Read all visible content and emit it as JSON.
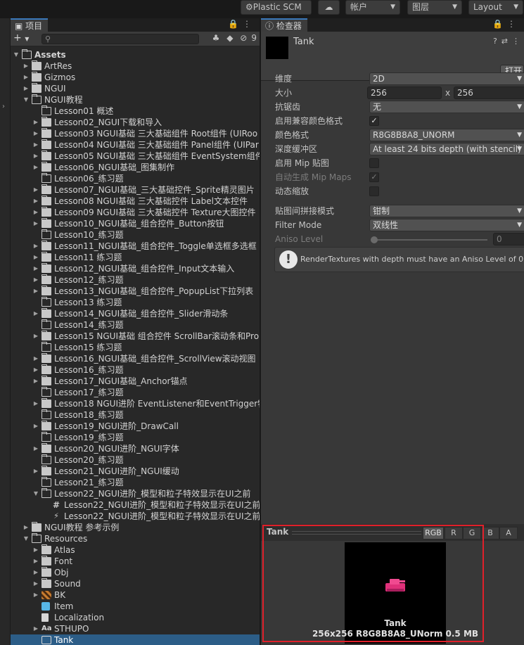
{
  "toolbar": {
    "plastic": "Plastic SCM",
    "account": "帐户",
    "layers": "图层",
    "layout": "Layout"
  },
  "project": {
    "tab_label": "项目",
    "search_placeholder": "",
    "hidden_count": "9",
    "tree": [
      {
        "label": "Assets",
        "depth": 0,
        "expanded": true,
        "icon": "folder-open",
        "bold": true
      },
      {
        "label": "ArtRes",
        "depth": 1,
        "expanded": false,
        "icon": "folder"
      },
      {
        "label": "Gizmos",
        "depth": 1,
        "expanded": false,
        "icon": "folder"
      },
      {
        "label": "NGUI",
        "depth": 1,
        "expanded": false,
        "icon": "folder"
      },
      {
        "label": "NGUI教程",
        "depth": 1,
        "expanded": true,
        "icon": "folder-open"
      },
      {
        "label": "Lesson01 概述",
        "depth": 2,
        "icon": "folder-empty"
      },
      {
        "label": "Lesson02_NGUI下载和导入",
        "depth": 2,
        "expanded": false,
        "icon": "folder"
      },
      {
        "label": "Lesson03 NGUI基础 三大基础组件 Root组件 (UIRoo",
        "depth": 2,
        "expanded": false,
        "icon": "folder"
      },
      {
        "label": "Lesson04 NGUI基础 三大基础组件 Panel组件 (UIPar",
        "depth": 2,
        "expanded": false,
        "icon": "folder"
      },
      {
        "label": "Lesson05 NGUI基础 三大基础组件 EventSystem组件",
        "depth": 2,
        "expanded": false,
        "icon": "folder"
      },
      {
        "label": "Lesson06_NGUI基础_图集制作",
        "depth": 2,
        "expanded": false,
        "icon": "folder"
      },
      {
        "label": "Lesson06_练习题",
        "depth": 2,
        "icon": "folder-empty"
      },
      {
        "label": "Lesson07_NGUI基础_三大基础控件_Sprite精灵图片",
        "depth": 2,
        "expanded": false,
        "icon": "folder"
      },
      {
        "label": "Lesson08 NGUI基础 三大基础控件 Label文本控件",
        "depth": 2,
        "expanded": false,
        "icon": "folder"
      },
      {
        "label": "Lesson09 NGUI基础 三大基础控件 Texture大图控件",
        "depth": 2,
        "expanded": false,
        "icon": "folder"
      },
      {
        "label": "Lesson10_NGUI基础_组合控件_Button按钮",
        "depth": 2,
        "expanded": false,
        "icon": "folder"
      },
      {
        "label": "Lesson10_练习题",
        "depth": 2,
        "icon": "folder-empty"
      },
      {
        "label": "Lesson11_NGUI基础_组合控件_Toggle单选框多选框",
        "depth": 2,
        "expanded": false,
        "icon": "folder"
      },
      {
        "label": "Lesson11 练习题",
        "depth": 2,
        "expanded": false,
        "icon": "folder"
      },
      {
        "label": "Lesson12_NGUI基础_组合控件_Input文本输入",
        "depth": 2,
        "expanded": false,
        "icon": "folder"
      },
      {
        "label": "Lesson12_练习题",
        "depth": 2,
        "expanded": false,
        "icon": "folder"
      },
      {
        "label": "Lesson13_NGUI基础_组合控件_PopupList下拉列表",
        "depth": 2,
        "expanded": false,
        "icon": "folder"
      },
      {
        "label": "Lesson13 练习题",
        "depth": 2,
        "icon": "folder-empty"
      },
      {
        "label": "Lesson14_NGUI基础_组合控件_Slider滑动条",
        "depth": 2,
        "expanded": false,
        "icon": "folder"
      },
      {
        "label": "Lesson14_练习题",
        "depth": 2,
        "icon": "folder-empty"
      },
      {
        "label": "Lesson15 NGUI基础 组合控件 ScrollBar滚动条和Pro",
        "depth": 2,
        "expanded": false,
        "icon": "folder"
      },
      {
        "label": "Lesson15 练习题",
        "depth": 2,
        "icon": "folder-empty"
      },
      {
        "label": "Lesson16_NGUI基础_组合控件_ScrollView滚动视图",
        "depth": 2,
        "expanded": false,
        "icon": "folder"
      },
      {
        "label": "Lesson16_练习题",
        "depth": 2,
        "expanded": false,
        "icon": "folder"
      },
      {
        "label": "Lesson17_NGUI基础_Anchor锚点",
        "depth": 2,
        "expanded": false,
        "icon": "folder"
      },
      {
        "label": "Lesson17_练习题",
        "depth": 2,
        "icon": "folder-empty"
      },
      {
        "label": "Lesson18 NGUI进阶 EventListener和EventTrigger特",
        "depth": 2,
        "expanded": false,
        "icon": "folder"
      },
      {
        "label": "Lesson18_练习题",
        "depth": 2,
        "icon": "folder-empty"
      },
      {
        "label": "Lesson19_NGUI进阶_DrawCall",
        "depth": 2,
        "expanded": false,
        "icon": "folder"
      },
      {
        "label": "Lesson19_练习题",
        "depth": 2,
        "icon": "folder-empty"
      },
      {
        "label": "Lesson20_NGUI进阶_NGUI字体",
        "depth": 2,
        "expanded": false,
        "icon": "folder"
      },
      {
        "label": "Lesson20_练习题",
        "depth": 2,
        "icon": "folder-empty"
      },
      {
        "label": "Lesson21_NGUI进阶_NGUI缓动",
        "depth": 2,
        "expanded": false,
        "icon": "folder"
      },
      {
        "label": "Lesson21_练习题",
        "depth": 2,
        "icon": "folder-empty"
      },
      {
        "label": "Lesson22_NGUI进阶_模型和粒子特效显示在UI之前",
        "depth": 2,
        "expanded": true,
        "icon": "folder-open"
      },
      {
        "label": "Lesson22_NGUI进阶_模型和粒子特效显示在UI之前",
        "depth": 3,
        "icon": "script"
      },
      {
        "label": "Lesson22_NGUI进阶_模型和粒子特效显示在UI之前",
        "depth": 3,
        "icon": "scene"
      },
      {
        "label": "NGUI教程 参考示例",
        "depth": 1,
        "expanded": false,
        "icon": "folder"
      },
      {
        "label": "Resources",
        "depth": 1,
        "expanded": true,
        "icon": "folder-open"
      },
      {
        "label": "Atlas",
        "depth": 2,
        "expanded": false,
        "icon": "folder"
      },
      {
        "label": "Font",
        "depth": 2,
        "expanded": false,
        "icon": "folder"
      },
      {
        "label": "Obj",
        "depth": 2,
        "expanded": false,
        "icon": "folder"
      },
      {
        "label": "Sound",
        "depth": 2,
        "expanded": false,
        "icon": "folder"
      },
      {
        "label": "BK",
        "depth": 2,
        "expanded": false,
        "icon": "bk"
      },
      {
        "label": "Item",
        "depth": 2,
        "icon": "prefab"
      },
      {
        "label": "Localization",
        "depth": 2,
        "icon": "doc"
      },
      {
        "label": "STHUPO",
        "depth": 2,
        "expanded": false,
        "icon": "font"
      },
      {
        "label": "Tank",
        "depth": 2,
        "icon": "rendertexture",
        "selected": true
      }
    ]
  },
  "inspector": {
    "tab_label": "检查器",
    "asset_name": "Tank",
    "open_label": "打开",
    "properties": {
      "dimension_label": "维度",
      "dimension_value": "2D",
      "size_label": "大小",
      "size_w": "256",
      "size_x": "x",
      "size_h": "256",
      "aa_label": "抗锯齿",
      "aa_value": "无",
      "compat_label": "启用兼容颜色格式",
      "compat_check": "✓",
      "color_format_label": "颜色格式",
      "color_format_value": "R8G8B8A8_UNORM",
      "depth_label": "深度缓冲区",
      "depth_value": "At least 24 bits depth (with stencil)",
      "mip_label": "启用 Mip 贴图",
      "automip_label": "自动生成 Mip Maps",
      "automip_check": "✓",
      "dynscale_label": "动态缩放",
      "wrap_label": "贴图间拼接模式",
      "wrap_value": "钳制",
      "filter_label": "Filter Mode",
      "filter_value": "双线性",
      "aniso_label": "Aniso Level",
      "aniso_value": "0",
      "aniso_level": 0
    },
    "help_text": "RenderTextures with depth must have an Aniso Level of 0."
  },
  "preview": {
    "title": "Tank",
    "channels": [
      "RGB",
      "R",
      "G",
      "B",
      "A"
    ],
    "label": "Tank",
    "info": "256x256  R8G8B8A8_UNorm  0.5 MB"
  },
  "colors": {
    "selection": "#2c5d87",
    "highlight_box": "#e0202a",
    "tank_pink": "#e0307a"
  }
}
